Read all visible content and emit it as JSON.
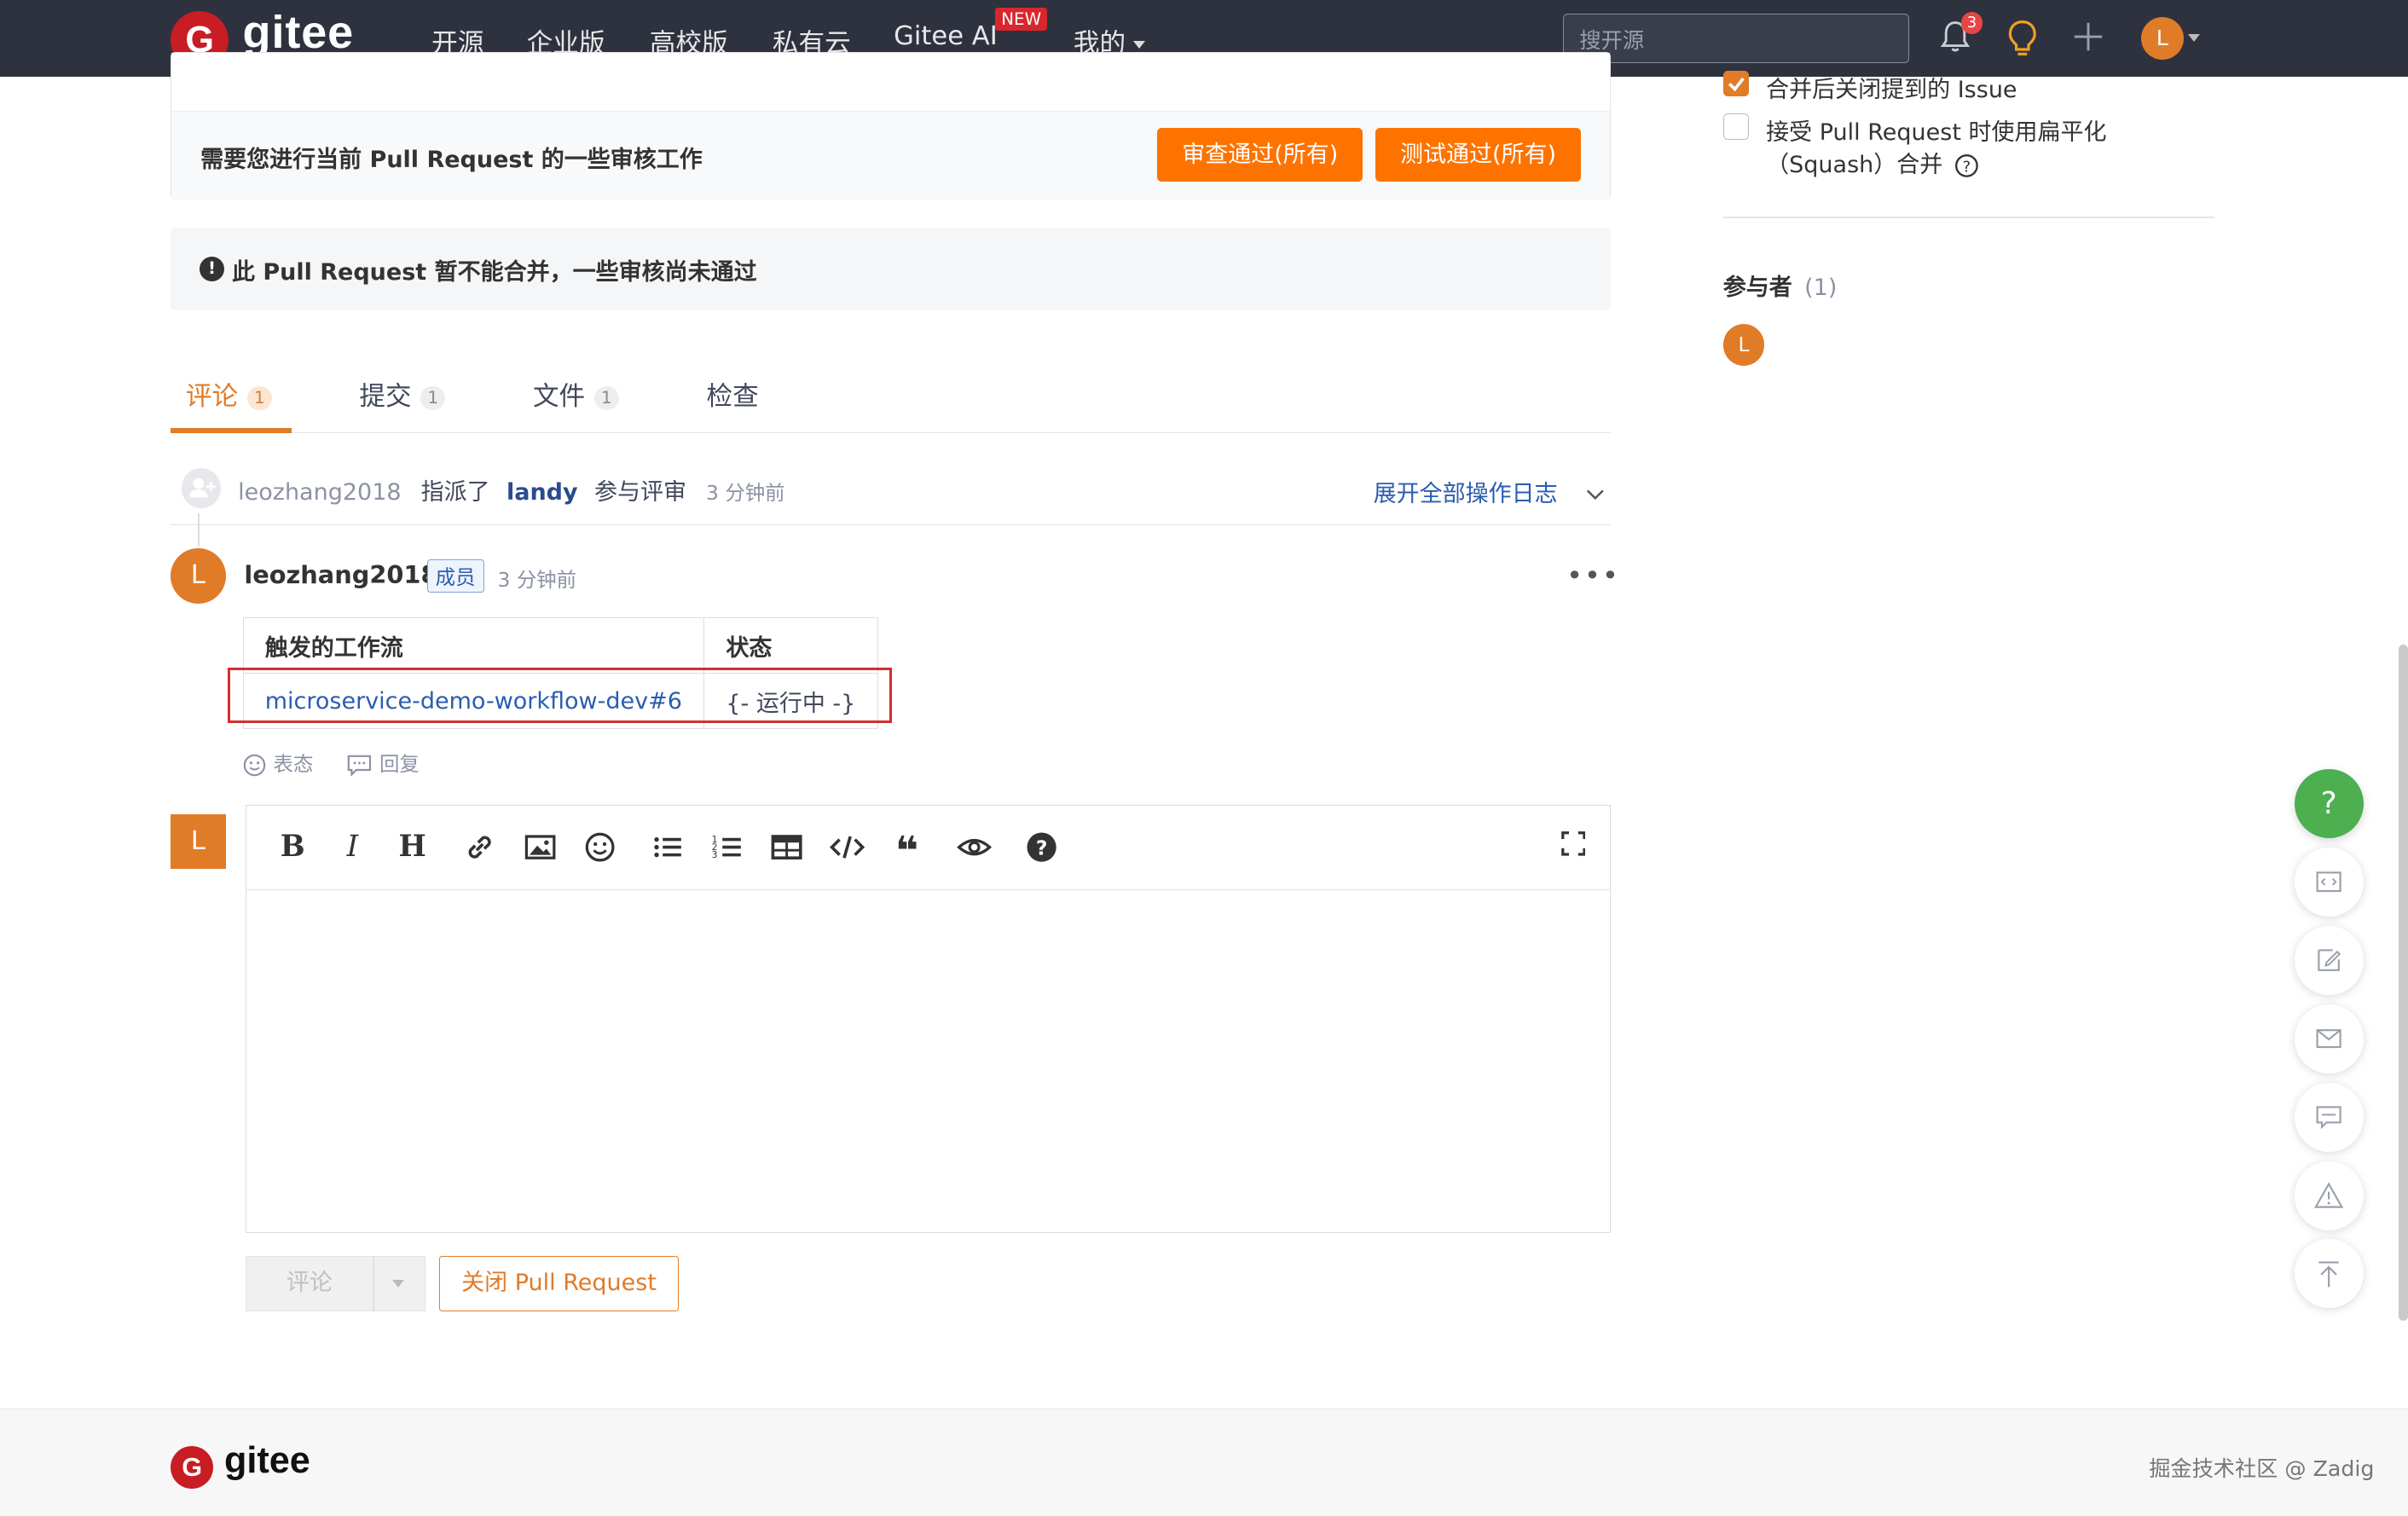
{
  "nav": {
    "logo_text": "gitee",
    "items": [
      "开源",
      "企业版",
      "高校版",
      "私有云",
      "Gitee AI",
      "我的"
    ],
    "new_badge": "NEW",
    "search_placeholder": "搜开源",
    "notification_count": "3",
    "avatar_letter": "L"
  },
  "review": {
    "message": "需要您进行当前 Pull Request 的一些审核工作",
    "approve_review_label": "审查通过(所有)",
    "approve_test_label": "测试通过(所有)"
  },
  "warning": {
    "text": "此 Pull Request 暂不能合并，一些审核尚未通过"
  },
  "tabs": [
    {
      "label": "评论",
      "count": "1"
    },
    {
      "label": "提交",
      "count": "1"
    },
    {
      "label": "文件",
      "count": "1"
    },
    {
      "label": "检查",
      "count": ""
    }
  ],
  "event": {
    "actor": "leozhang2018",
    "action": "指派了",
    "target": "landy",
    "suffix": "参与评审",
    "time": "3 分钟前",
    "expand_label": "展开全部操作日志"
  },
  "comment": {
    "avatar_letter": "L",
    "author": "leozhang2018",
    "badge": "成员",
    "time": "3 分钟前",
    "more": "•••",
    "table": {
      "headers": [
        "触发的工作流",
        "状态"
      ],
      "rows": [
        [
          "microservice-demo-workflow-dev#6",
          "{- 运行中 -}"
        ]
      ]
    },
    "react_label": "表态",
    "reply_label": "回复"
  },
  "editor": {
    "avatar_letter": "L",
    "toolbar": [
      "B",
      "I",
      "H",
      "link-icon",
      "image-icon",
      "emoji-icon",
      "bullet-list-icon",
      "numbered-list-icon",
      "table-icon",
      "code-icon",
      "quote-icon",
      "preview-icon",
      "help-icon"
    ],
    "submit_label": "评论",
    "close_pr_label": "关闭 Pull Request"
  },
  "sidebar": {
    "options": [
      {
        "label": "合并后关闭提到的 Issue",
        "checked": true
      },
      {
        "label": "接受 Pull Request 时使用扁平化",
        "label2": "（Squash）合并",
        "checked": false
      }
    ],
    "participants_title": "参与者",
    "participants_count": "(1)",
    "participant_letter": "L"
  },
  "floating": {
    "help": "?"
  },
  "footer": {
    "logo_text": "gitee",
    "watermark": "掘金技术社区 @ Zadig"
  },
  "colors": {
    "accent": "#e07b28",
    "button_orange": "#fe7300",
    "nav_bg": "#2e323e",
    "brand_red": "#c71d23",
    "highlight_red": "#d32f2f",
    "help_green": "#4caf50"
  }
}
